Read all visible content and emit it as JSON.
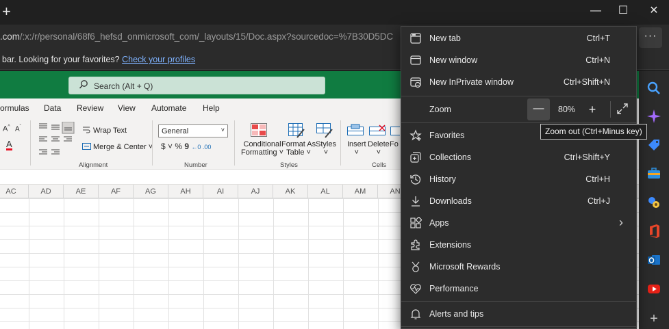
{
  "window": {
    "new_tab_glyph": "+",
    "minimize_glyph": "—",
    "maximize_glyph": "☐",
    "close_glyph": "✕"
  },
  "address": {
    "url_prefix": ".com",
    "url_rest": "/:x:/r/personal/68f6_hefsd_onmicrosoft_com/_layouts/15/Doc.aspx?sourcedoc=%7B30D5DC",
    "more_label": "···"
  },
  "favorites_bar": {
    "message": "bar. Looking for your favorites?",
    "link": "Check your profiles"
  },
  "excel": {
    "search_placeholder": "Search (Alt + Q)",
    "tabs": [
      "ormulas",
      "Data",
      "Review",
      "View",
      "Automate",
      "Help"
    ],
    "ribbon": {
      "wrap_text": "Wrap Text",
      "merge_center": "Merge & Center",
      "number_format": "General",
      "conditional_formatting": [
        "Conditional",
        "Formatting"
      ],
      "format_as_table": [
        "Format As",
        "Table"
      ],
      "styles": "Styles",
      "insert": "Insert",
      "delete": "Delete",
      "format_partial": "Fo",
      "groups": {
        "alignment": "Alignment",
        "number": "Number",
        "styles": "Styles",
        "cells": "Cells"
      }
    },
    "columns": [
      "AC",
      "AD",
      "AE",
      "AF",
      "AG",
      "AH",
      "AI",
      "AJ",
      "AK",
      "AL",
      "AM",
      "AN"
    ]
  },
  "menu": {
    "items_top": [
      {
        "label": "New tab",
        "shortcut": "Ctrl+T",
        "icon": "new-tab-icon"
      },
      {
        "label": "New window",
        "shortcut": "Ctrl+N",
        "icon": "new-window-icon"
      },
      {
        "label": "New InPrivate window",
        "shortcut": "Ctrl+Shift+N",
        "icon": "inprivate-icon"
      }
    ],
    "zoom": {
      "label": "Zoom",
      "value": "80%",
      "minus": "—",
      "plus": "+"
    },
    "items_mid": [
      {
        "label": "Favorites",
        "shortcut": "",
        "icon": "star-icon"
      },
      {
        "label": "Collections",
        "shortcut": "Ctrl+Shift+Y",
        "icon": "collections-icon"
      },
      {
        "label": "History",
        "shortcut": "Ctrl+H",
        "icon": "history-icon"
      },
      {
        "label": "Downloads",
        "shortcut": "Ctrl+J",
        "icon": "download-icon"
      },
      {
        "label": "Apps",
        "shortcut": "",
        "icon": "apps-icon"
      },
      {
        "label": "Extensions",
        "shortcut": "",
        "icon": "puzzle-icon"
      },
      {
        "label": "Microsoft Rewards",
        "shortcut": "",
        "icon": "rewards-icon"
      },
      {
        "label": "Performance",
        "shortcut": "",
        "icon": "performance-icon"
      }
    ],
    "items_bottom": [
      {
        "label": "Alerts and tips",
        "shortcut": "",
        "icon": "bell-icon"
      }
    ],
    "apps_chevron": "›"
  },
  "tooltip": "Zoom out (Ctrl+Minus key)",
  "colors": {
    "excel_green": "#107c41",
    "menu_bg": "#2c2c2c",
    "link": "#7fb3ff"
  }
}
